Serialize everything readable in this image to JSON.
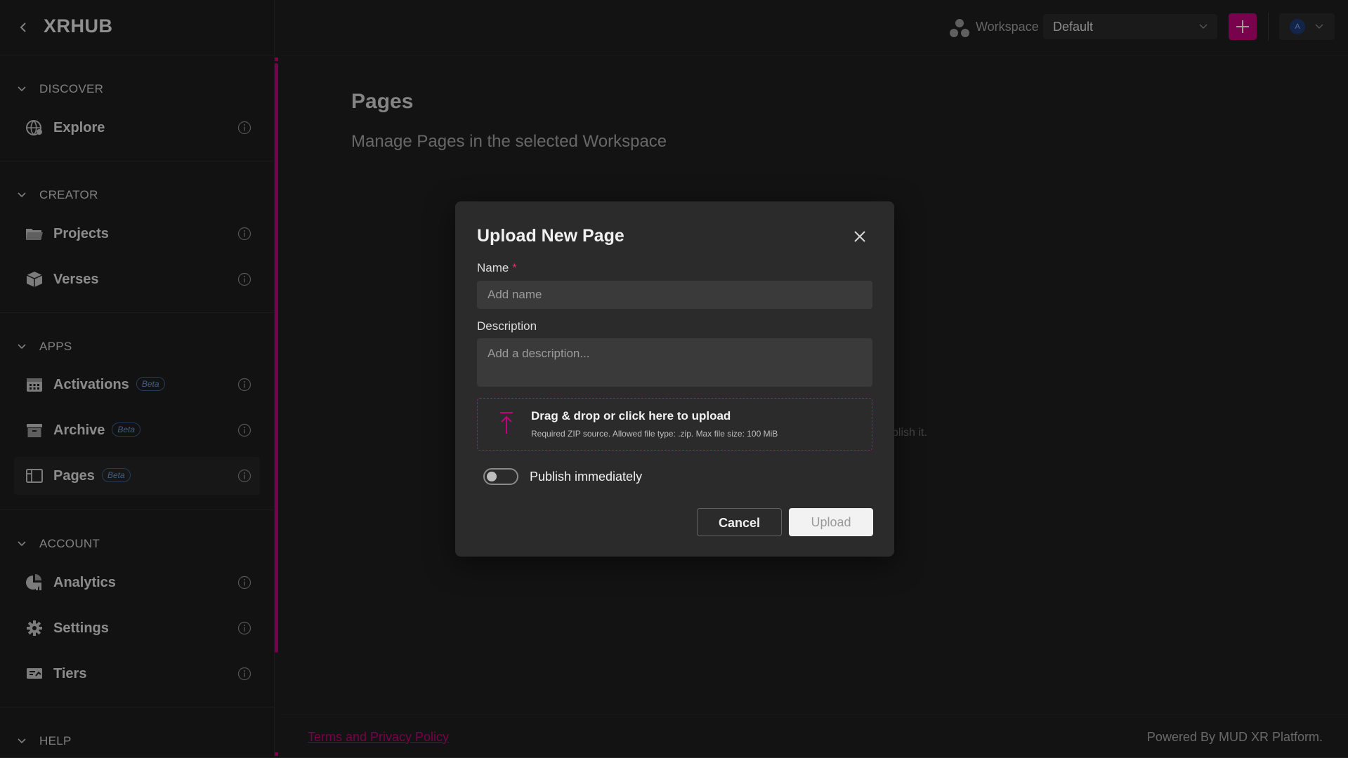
{
  "app": {
    "brand": "XRHUB"
  },
  "topbar": {
    "workspace_label": "Workspace",
    "workspace_value": "Default",
    "avatar_initial": "A"
  },
  "sidebar": {
    "sections": [
      {
        "title": "DISCOVER",
        "items": [
          {
            "label": "Explore",
            "icon": "globe-icon"
          }
        ]
      },
      {
        "title": "CREATOR",
        "items": [
          {
            "label": "Projects",
            "icon": "folder-icon"
          },
          {
            "label": "Verses",
            "icon": "cube-icon"
          }
        ]
      },
      {
        "title": "APPS",
        "items": [
          {
            "label": "Activations",
            "icon": "calendar-icon",
            "badge": "Beta"
          },
          {
            "label": "Archive",
            "icon": "archive-icon",
            "badge": "Beta"
          },
          {
            "label": "Pages",
            "icon": "layout-icon",
            "badge": "Beta",
            "active": true
          }
        ]
      },
      {
        "title": "ACCOUNT",
        "items": [
          {
            "label": "Analytics",
            "icon": "chart-icon"
          },
          {
            "label": "Settings",
            "icon": "gear-icon"
          },
          {
            "label": "Tiers",
            "icon": "ticket-icon"
          }
        ]
      },
      {
        "title": "HELP",
        "items": []
      }
    ]
  },
  "main": {
    "title": "Pages",
    "subtitle": "Manage Pages in the selected Workspace",
    "bg_hint": "blish it."
  },
  "footer": {
    "terms": "Terms and Privacy Policy",
    "powered": "Powered By MUD XR Platform."
  },
  "modal": {
    "title": "Upload New Page",
    "name_label": "Name",
    "name_required": "*",
    "name_placeholder": "Add name",
    "name_value": "",
    "description_label": "Description",
    "description_placeholder": "Add a description...",
    "description_value": "",
    "dropzone_title": "Drag & drop or click here to upload",
    "dropzone_sub": "Required ZIP source. Allowed file type: .zip. Max file size: 100 MiB",
    "publish_label": "Publish immediately",
    "publish_on": false,
    "cancel_label": "Cancel",
    "upload_label": "Upload"
  },
  "colors": {
    "accent": "#c2047a",
    "background": "#1f1f1f",
    "modal": "#2b2b2b"
  }
}
